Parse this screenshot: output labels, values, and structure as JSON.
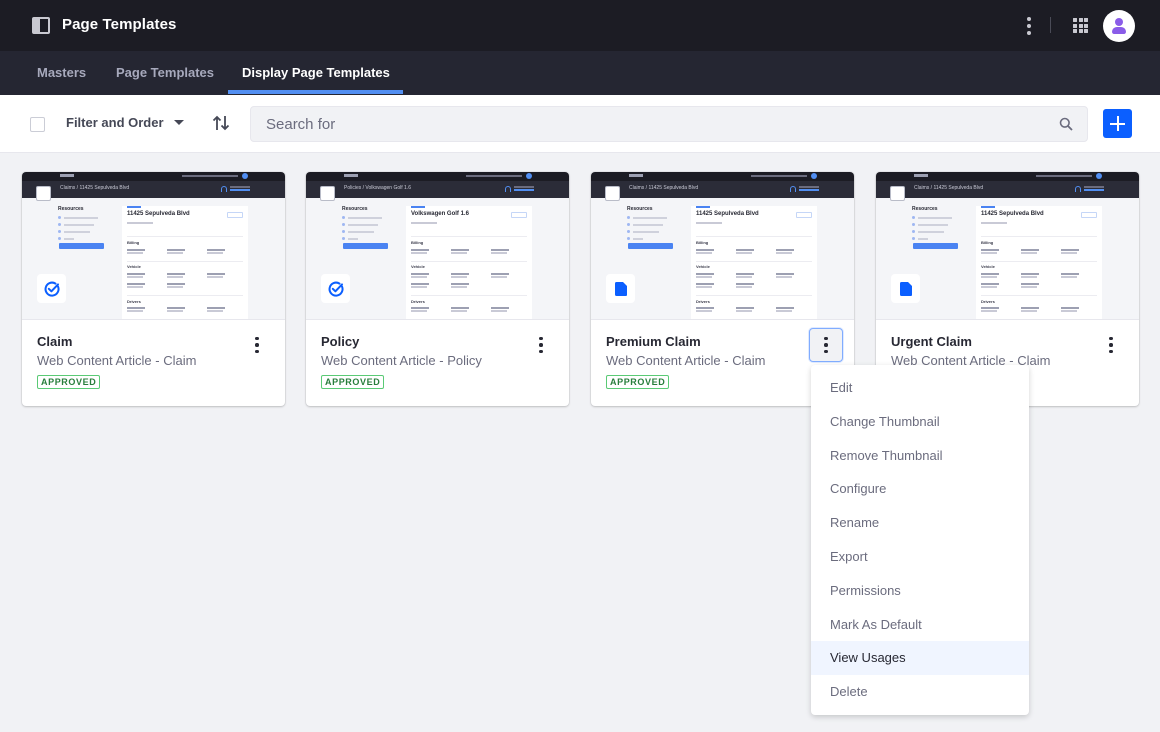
{
  "app": {
    "title": "Page Templates",
    "icons": {
      "panel": "product-menu-icon",
      "options": "ellipsis-v-icon",
      "apps": "grid-icon",
      "user": "user-avatar-icon"
    }
  },
  "nav": {
    "tabs": [
      {
        "label": "Masters",
        "active": false
      },
      {
        "label": "Page Templates",
        "active": false
      },
      {
        "label": "Display Page Templates",
        "active": true
      }
    ],
    "accent": "#528ff2"
  },
  "toolbar": {
    "filter_label": "Filter and Order",
    "search_placeholder": "Search for",
    "search_value": "",
    "add_button_color": "#0b5fff"
  },
  "cards": [
    {
      "title": "Claim",
      "subtitle": "Web Content Article - Claim",
      "status": "APPROVED",
      "sticker": "check-circle-icon",
      "preview": {
        "breadcrumb": "Claims / 11425 Sepulveda Blvd",
        "heading": "11425 Sepulveda Blvd",
        "sidebar": "Resources",
        "sections": [
          "Billing",
          "Vehicle",
          "Drivers"
        ]
      }
    },
    {
      "title": "Policy",
      "subtitle": "Web Content Article - Policy",
      "status": "APPROVED",
      "sticker": "check-circle-icon",
      "preview": {
        "breadcrumb": "Policies / Volkswagen Golf 1.6",
        "heading": "Volkswagen Golf 1.6",
        "sidebar": "Resources",
        "sections": [
          "Billing",
          "Vehicle",
          "Drivers"
        ]
      }
    },
    {
      "title": "Premium Claim",
      "subtitle": "Web Content Article - Claim",
      "status": "APPROVED",
      "sticker": "document-icon",
      "preview": {
        "breadcrumb": "Claims / 11425 Sepulveda Blvd",
        "heading": "11425 Sepulveda Blvd",
        "sidebar": "Resources",
        "sections": [
          "Billing",
          "Vehicle",
          "Drivers"
        ]
      }
    },
    {
      "title": "Urgent Claim",
      "subtitle": "Web Content Article - Claim",
      "status": "",
      "sticker": "document-icon",
      "preview": {
        "breadcrumb": "Claims / 11425 Sepulveda Blvd",
        "heading": "11425 Sepulveda Blvd",
        "sidebar": "Resources",
        "sections": [
          "Billing",
          "Vehicle",
          "Drivers"
        ]
      }
    }
  ],
  "menu": {
    "open_for": "Premium Claim",
    "items": [
      {
        "label": "Edit"
      },
      {
        "label": "Change Thumbnail"
      },
      {
        "label": "Remove Thumbnail"
      },
      {
        "label": "Configure"
      },
      {
        "label": "Rename"
      },
      {
        "label": "Export"
      },
      {
        "label": "Permissions"
      },
      {
        "label": "Mark As Default"
      },
      {
        "label": "View Usages",
        "highlighted": true
      },
      {
        "label": "Delete"
      }
    ]
  },
  "colors": {
    "approved_text": "#287d3c",
    "approved_border": "#5aca75",
    "sticker_blue": "#0b5fff",
    "menu_hover": "#f0f5ff"
  }
}
